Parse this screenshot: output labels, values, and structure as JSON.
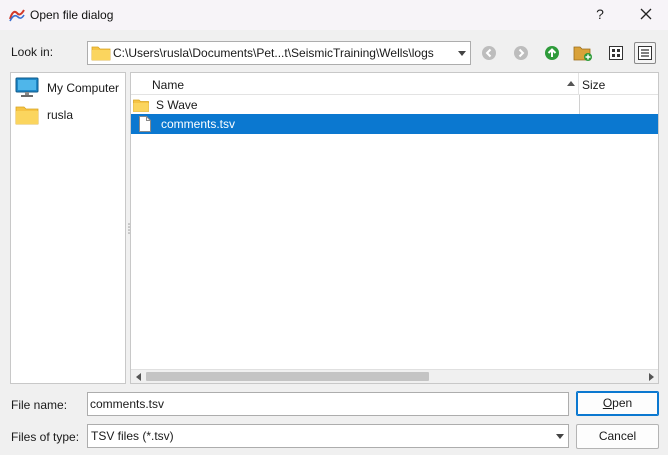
{
  "window": {
    "title": "Open file dialog",
    "help_label": "?"
  },
  "look_in": {
    "label": "Look in:",
    "path": "C:\\Users\\rusla\\Documents\\Pet...t\\SeismicTraining\\Wells\\logs"
  },
  "toolbar": {
    "icons": [
      "back-icon",
      "forward-icon",
      "parent-folder-icon",
      "new-folder-icon",
      "icon-view-icon",
      "detail-view-icon"
    ]
  },
  "sidebar": {
    "items": [
      {
        "label": "My Computer",
        "icon": "computer-icon"
      },
      {
        "label": "rusla",
        "icon": "folder-icon"
      }
    ]
  },
  "file_list": {
    "columns": [
      "Name",
      "Size"
    ],
    "rows": [
      {
        "name": "S Wave",
        "type": "folder",
        "selected": false
      },
      {
        "name": "comments.tsv",
        "type": "file",
        "selected": true
      }
    ]
  },
  "file_name": {
    "label": "File name:",
    "value": "comments.tsv"
  },
  "files_of_type": {
    "label": "Files of type:",
    "value": "TSV files (*.tsv)"
  },
  "buttons": {
    "open_prefix": "O",
    "open_rest": "pen",
    "cancel": "Cancel"
  },
  "colors": {
    "selection": "#0b78d0",
    "folder": "#f6c445"
  }
}
